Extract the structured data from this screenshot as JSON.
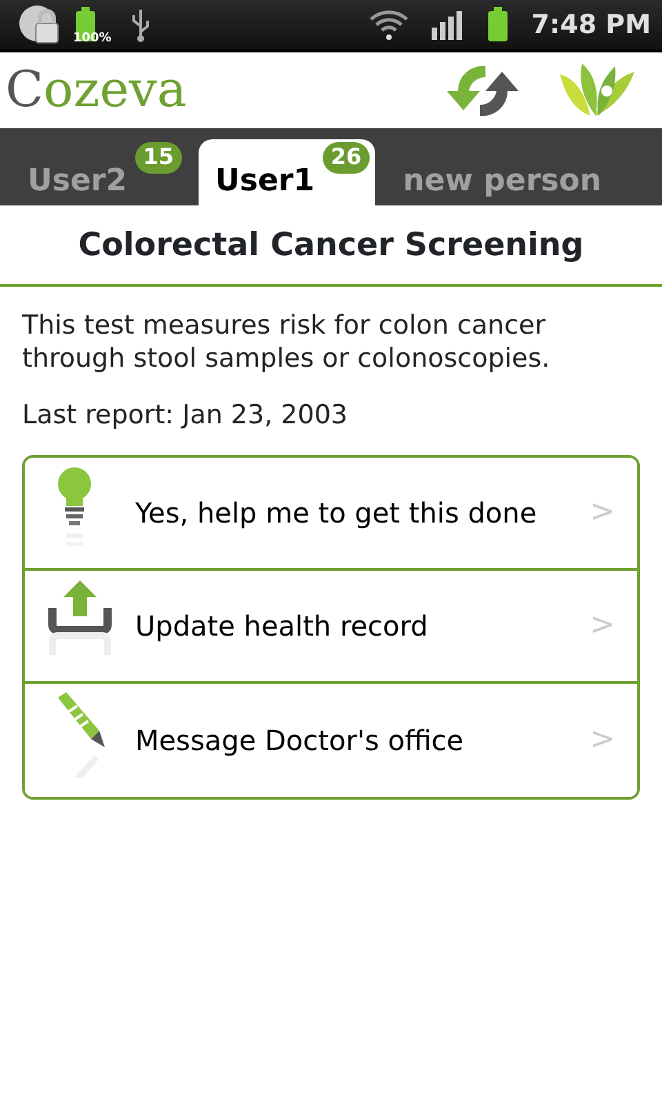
{
  "status_bar": {
    "battery_percent": "100%",
    "time": "7:48 PM"
  },
  "header": {
    "logo_initial": "C",
    "logo_rest": "ozeva"
  },
  "tabs": [
    {
      "label": "User2",
      "badge": "15",
      "selected": false
    },
    {
      "label": "User1",
      "badge": "26",
      "selected": true
    },
    {
      "label": "new person",
      "selected": false
    }
  ],
  "title": "Colorectal Cancer Screening",
  "description": "This test measures risk for colon cancer through stool samples or colonoscopies.",
  "last_report": "Last report: Jan 23, 2003",
  "actions": [
    {
      "kind": "bulb",
      "label": "Yes, help me to get this done",
      "chevron": ">"
    },
    {
      "kind": "upload",
      "label": "Update health record",
      "chevron": ">"
    },
    {
      "kind": "pencil",
      "label": "Message Doctor's office",
      "chevron": ">"
    }
  ]
}
